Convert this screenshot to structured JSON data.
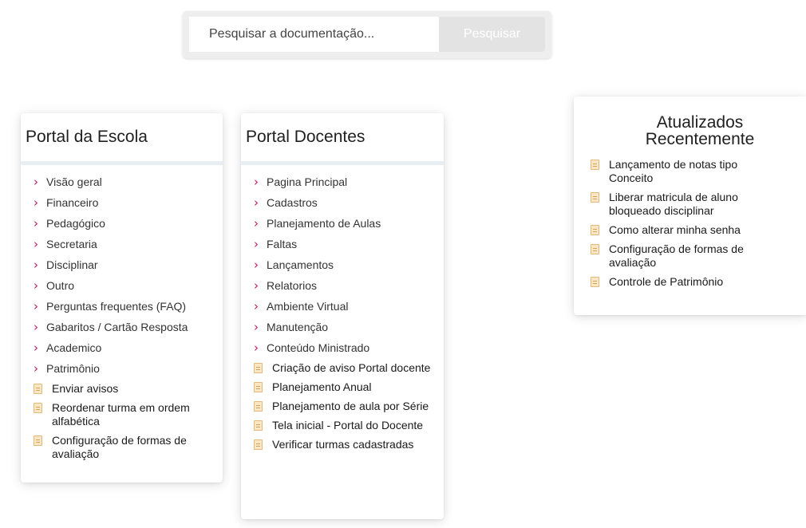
{
  "search": {
    "placeholder": "Pesquisar a documentação...",
    "button_label": "Pesquisar"
  },
  "colors": {
    "chevron": "#c2185b",
    "search_button_bg": "#e3e3e3",
    "title_bar": "#e9eef2"
  },
  "icons": {
    "category": "chevron-right-icon",
    "document": "document-icon"
  },
  "portal_escola": {
    "title": "Portal da Escola",
    "categories": [
      "Visão geral",
      "Financeiro",
      "Pedagógico",
      "Secretaria",
      "Disciplinar",
      "Outro",
      "Perguntas frequentes (FAQ)",
      "Gabaritos / Cartão Resposta",
      "Academico",
      "Patrimônio"
    ],
    "documents": [
      "Enviar avisos",
      "Reordenar turma em ordem alfabética",
      "Configuração de formas de avaliação"
    ]
  },
  "portal_docentes": {
    "title": "Portal Docentes",
    "categories": [
      "Pagina Principal",
      "Cadastros",
      "Planejamento de Aulas",
      "Faltas",
      "Lançamentos",
      "Relatorios",
      "Ambiente Virtual",
      "Manutenção",
      "Conteúdo Ministrado"
    ],
    "documents": [
      "Criação de aviso Portal docente",
      "Planejamento Anual",
      "Planejamento de aula por Série",
      "Tela inicial - Portal do Docente",
      "Verificar turmas cadastradas"
    ]
  },
  "recent": {
    "title": "Atualizados Recentemente",
    "documents": [
      "Lançamento de notas tipo Conceito",
      "Liberar matricula de aluno bloqueado disciplinar",
      "Como alterar minha senha",
      "Configuração de formas de avaliação",
      "Controle de Patrimônio"
    ]
  }
}
